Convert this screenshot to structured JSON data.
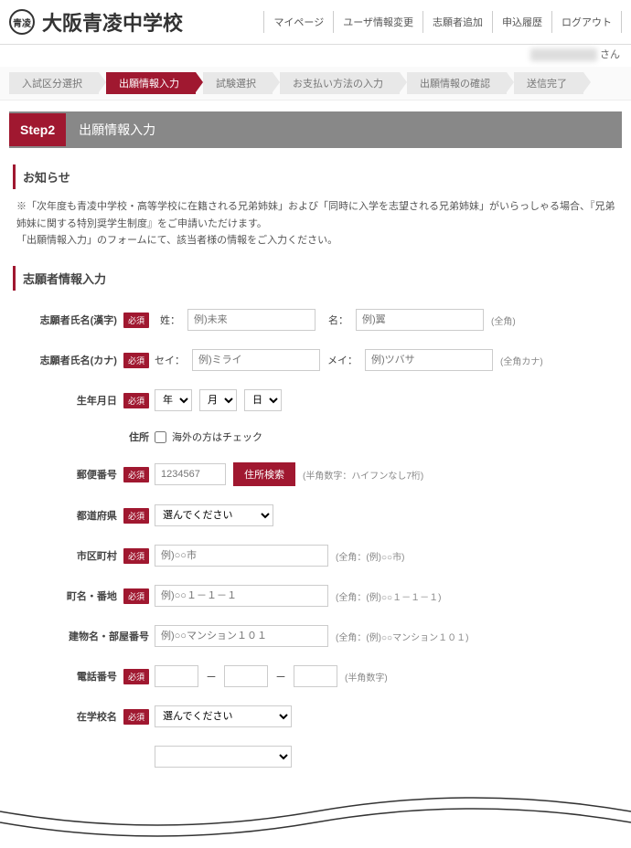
{
  "header": {
    "logo_text": "青凌",
    "school_name": "大阪青凌中学校",
    "nav": [
      "マイページ",
      "ユーザ情報変更",
      "志願者追加",
      "申込履歴",
      "ログアウト"
    ],
    "user_suffix": "さん"
  },
  "breadcrumb": {
    "items": [
      "入試区分選択",
      "出願情報入力",
      "試験選択",
      "お支払い方法の入力",
      "出願情報の確認",
      "送信完了"
    ],
    "active_index": 1
  },
  "step": {
    "badge": "Step2",
    "title": "出願情報入力"
  },
  "notice": {
    "title": "お知らせ",
    "line1": "※「次年度も青凌中学校・高等学校に在籍される兄弟姉妹」および「同時に入学を志望される兄弟姉妹」がいらっしゃる場合、『兄弟姉妹に関する特別奨学生制度』をご申請いただけます。",
    "line2": "「出願情報入力」のフォームにて、該当者様の情報をご入力ください。"
  },
  "form": {
    "section_title": "志願者情報入力",
    "required_badge": "必須",
    "rows": {
      "name_kanji": {
        "label": "志願者氏名(漢字)",
        "sei_label": "姓：",
        "sei_ph": "例)未来",
        "mei_label": "名：",
        "mei_ph": "例)翼",
        "hint": "(全角)"
      },
      "name_kana": {
        "label": "志願者氏名(カナ)",
        "sei_label": "セイ：",
        "sei_ph": "例)ミライ",
        "mei_label": "メイ：",
        "mei_ph": "例)ツバサ",
        "hint": "(全角カナ)"
      },
      "birth": {
        "label": "生年月日",
        "year_ph": "年",
        "month_ph": "月",
        "day_ph": "日"
      },
      "address_head": {
        "label": "住所",
        "checkbox_label": "海外の方はチェック"
      },
      "zip": {
        "label": "郵便番号",
        "ph": "1234567",
        "btn": "住所検索",
        "hint": "(半角数字：ハイフンなし7桁)"
      },
      "pref": {
        "label": "都道府県",
        "ph": "選んでください"
      },
      "city": {
        "label": "市区町村",
        "ph": "例)○○市",
        "hint": "(全角：(例)○○市)"
      },
      "street": {
        "label": "町名・番地",
        "ph": "例)○○１－１－１",
        "hint": "(全角：(例)○○１－１－１)"
      },
      "building": {
        "label": "建物名・部屋番号",
        "ph": "例)○○マンション１０１",
        "hint": "(全角：(例)○○マンション１０１)"
      },
      "tel": {
        "label": "電話番号",
        "sep": "－",
        "hint": "(半角数字)"
      },
      "school": {
        "label": "在学校名",
        "ph": "選んでください"
      }
    }
  }
}
